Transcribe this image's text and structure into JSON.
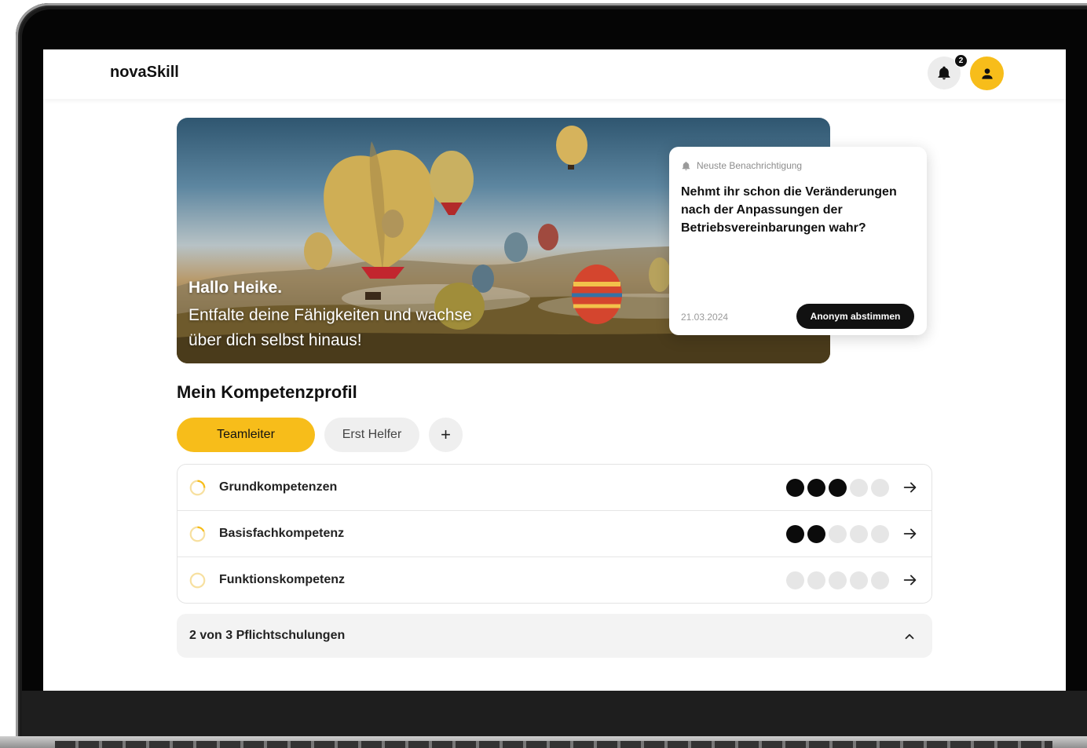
{
  "app": {
    "brand": "novaSkill",
    "notification_count": "2"
  },
  "hero": {
    "greeting": "Hallo Heike.",
    "tagline": "Entfalte deine Fähigkeiten und wachse über dich selbst hinaus!"
  },
  "notification": {
    "label": "Neuste Benachrichtigung",
    "question": "Nehmt ihr schon die Veränderungen nach der Anpassungen der Betriebsvereinbarungen wahr?",
    "date": "21.03.2024",
    "action_label": "Anonym abstimmen"
  },
  "profile": {
    "title": "Mein Kompetenzprofil",
    "tabs": [
      {
        "label": "Teamleiter",
        "active": true
      },
      {
        "label": "Erst Helfer",
        "active": false
      }
    ],
    "add_label": "+",
    "competencies": [
      {
        "label": "Grundkompetenzen",
        "level": 3,
        "max": 5
      },
      {
        "label": "Basisfachkompetenz",
        "level": 2,
        "max": 5
      },
      {
        "label": "Funktionskompetenz",
        "level": 0,
        "max": 5
      }
    ]
  },
  "trainings": {
    "summary": "2 von 3 Pflichtschulungen"
  },
  "colors": {
    "accent": "#f7bd1a",
    "dark": "#0b0b0b",
    "inactive_dot": "#e6e6e6"
  },
  "icons": {
    "bell": "bell-icon",
    "avatar": "user-icon",
    "row_status": "progress-ring-icon",
    "row_action": "arrow-right-icon",
    "collapse": "chevron-up-icon"
  }
}
